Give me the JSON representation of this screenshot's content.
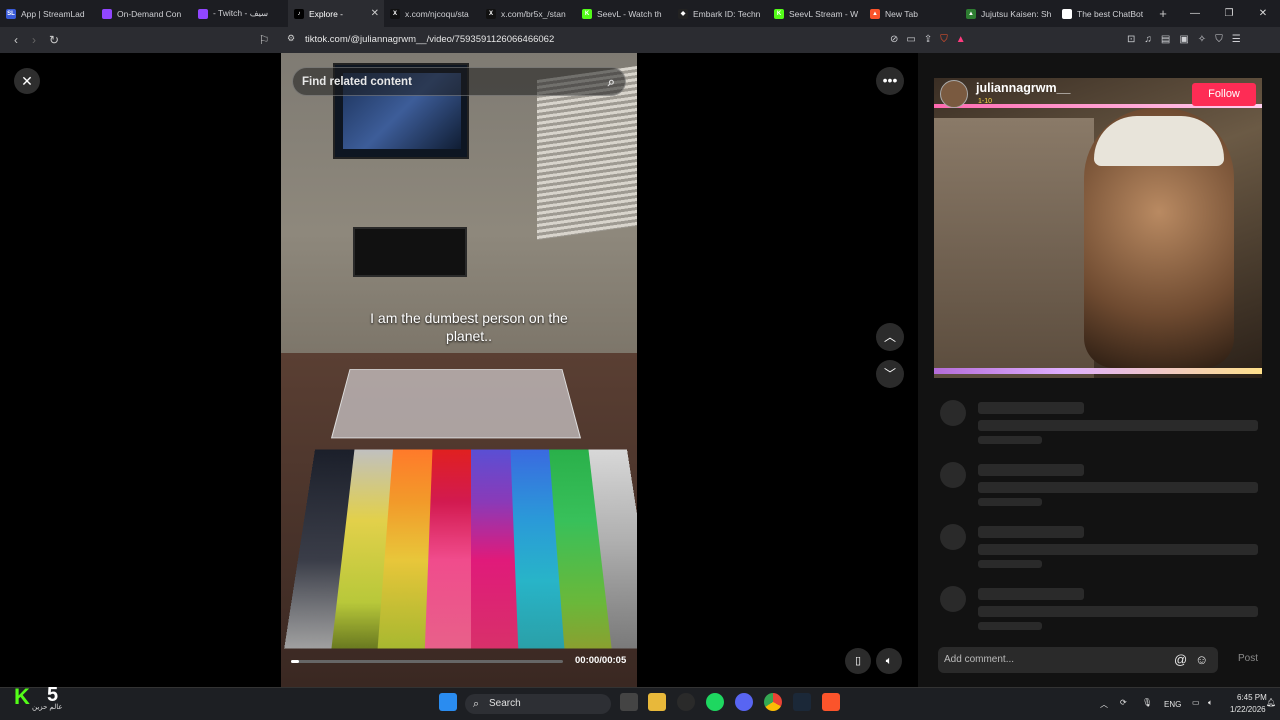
{
  "browser": {
    "tabs": [
      {
        "label": "App | StreamLad",
        "fav_color": "#3a5bd9",
        "fav_text": "SL"
      },
      {
        "label": "On-Demand Con",
        "fav_color": "#9146ff",
        "fav_text": ""
      },
      {
        "label": "- Twitch - سیف",
        "fav_color": "#9146ff",
        "fav_text": ""
      },
      {
        "label": "Explore -",
        "fav_color": "#000000",
        "fav_text": "♪",
        "active": true
      },
      {
        "label": "x.com/njcoqu/sta",
        "fav_color": "#111111",
        "fav_text": "X"
      },
      {
        "label": "x.com/br5x_/stan",
        "fav_color": "#111111",
        "fav_text": "X"
      },
      {
        "label": "SeevL - Watch th",
        "fav_color": "#53fc18",
        "fav_text": "K"
      },
      {
        "label": "Embark ID: Techn",
        "fav_color": "#222222",
        "fav_text": "◆"
      },
      {
        "label": "SeevL Stream - W",
        "fav_color": "#53fc18",
        "fav_text": "K"
      },
      {
        "label": "New Tab",
        "fav_color": "#fb542b",
        "fav_text": "▲"
      },
      {
        "label": "Jujutsu Kaisen: Sh",
        "fav_color": "#2e7d32",
        "fav_text": "▲"
      },
      {
        "label": "The best ChatBot",
        "fav_color": "#ffffff",
        "fav_text": "◆"
      }
    ],
    "new_tab_icon": "+",
    "url": "tiktok.com/@juliannagrwm__/video/7593591126066466062"
  },
  "video": {
    "search_placeholder": "Find related content",
    "caption": "I am the dumbest person on the planet..",
    "time": "00:00/00:05",
    "progress": 0.03
  },
  "panel": {
    "username": "juliannagrwm__",
    "badges": "1-10",
    "follow_label": "Follow",
    "comment_placeholder": "Add comment...",
    "post_label": "Post"
  },
  "taskbar": {
    "search_label": "Search",
    "kick_number": "5",
    "kick_text": "عالم حزين",
    "lang": "ENG",
    "time": "6:45 PM",
    "date": "1/22/2026"
  },
  "colors": {
    "follow": "#fe2c55",
    "kick": "#53fc18"
  }
}
